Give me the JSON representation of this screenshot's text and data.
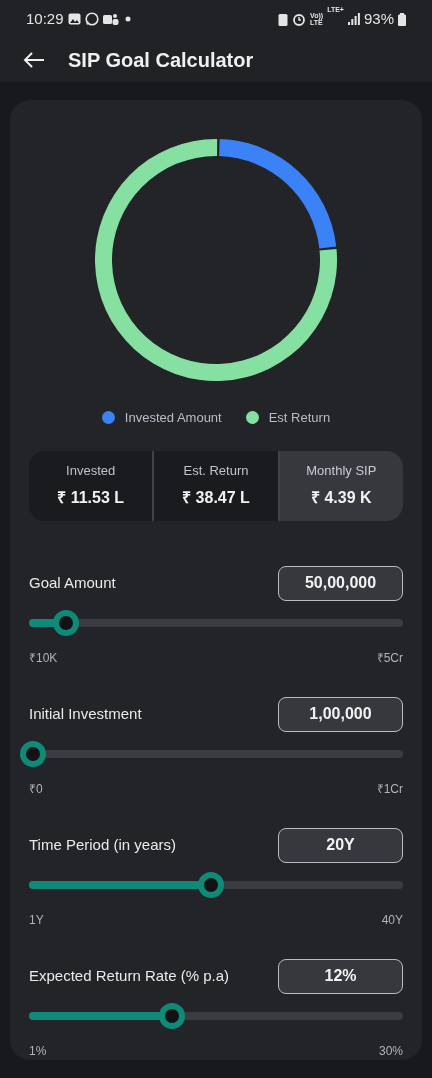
{
  "status_bar": {
    "time": "10:29",
    "volte": [
      "Vo))",
      "LTE"
    ],
    "network": "LTE+",
    "battery": "93%"
  },
  "app_bar": {
    "title": "SIP Goal Calculator"
  },
  "chart_data": {
    "type": "donut",
    "categories": [
      "Invested Amount",
      "Est Return"
    ],
    "values": [
      23.06,
      76.94
    ],
    "colors": [
      "#3b82f6",
      "#86e0a2"
    ]
  },
  "summary": [
    {
      "label": "Invested",
      "value": "₹ 11.53 L",
      "selected": false
    },
    {
      "label": "Est. Return",
      "value": "₹ 38.47 L",
      "selected": false
    },
    {
      "label": "Monthly SIP",
      "value": "₹ 4.39 K",
      "selected": true
    }
  ],
  "inputs": [
    {
      "label": "Goal Amount",
      "value": "50,00,000",
      "level": 0.1,
      "min": "₹10K",
      "max": "₹5Cr"
    },
    {
      "label": "Initial Investment",
      "value": "1,00,000",
      "level": 0,
      "min": "₹0",
      "max": "₹1Cr"
    },
    {
      "label": "Time Period (in years)",
      "value": "20Y",
      "level": 0.487,
      "min": "1Y",
      "max": "40Y"
    },
    {
      "label": "Expected Return Rate (% p.a)",
      "value": "12%",
      "level": 0.383,
      "min": "1%",
      "max": "30%"
    }
  ]
}
